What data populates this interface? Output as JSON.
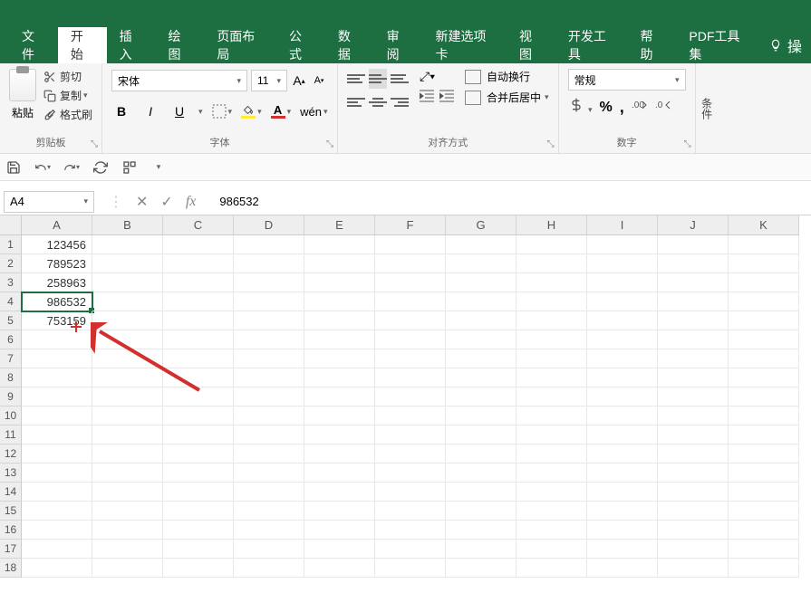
{
  "tabs": {
    "file": "文件",
    "home": "开始",
    "insert": "插入",
    "draw": "绘图",
    "page_layout": "页面布局",
    "formulas": "公式",
    "data": "数据",
    "review": "审阅",
    "new_tab": "新建选项卡",
    "view": "视图",
    "dev_tools": "开发工具",
    "help": "帮助",
    "pdf_toolkit": "PDF工具集",
    "tell_me": "操"
  },
  "ribbon": {
    "clipboard": {
      "paste": "粘贴",
      "cut": "剪切",
      "copy": "复制",
      "format_painter": "格式刷",
      "group_label": "剪贴板"
    },
    "font": {
      "name": "宋体",
      "size": "11",
      "bold": "B",
      "italic": "I",
      "underline": "U",
      "group_label": "字体"
    },
    "alignment": {
      "wrap_text": "自动换行",
      "merge_center": "合并后居中",
      "group_label": "对齐方式"
    },
    "number": {
      "format": "常规",
      "percent": "%",
      "comma": ",",
      "group_label": "数字"
    },
    "partial": "条件"
  },
  "name_box": "A4",
  "formula_value": "986532",
  "columns": [
    "A",
    "B",
    "C",
    "D",
    "E",
    "F",
    "G",
    "H",
    "I",
    "J",
    "K"
  ],
  "row_count": 18,
  "cells": {
    "A1": "123456",
    "A2": "789523",
    "A3": "258963",
    "A4": "986532",
    "A5": "753159"
  },
  "selected_cell": "A4"
}
